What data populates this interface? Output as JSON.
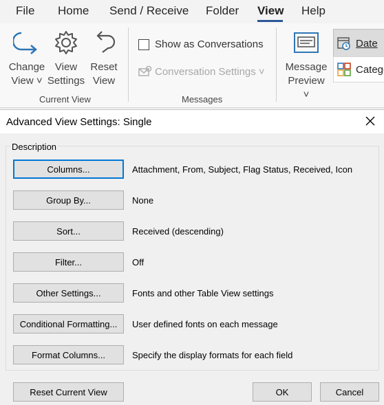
{
  "ribbon": {
    "tabs": [
      {
        "label": "File"
      },
      {
        "label": "Home"
      },
      {
        "label": "Send / Receive"
      },
      {
        "label": "Folder"
      },
      {
        "label": "View"
      },
      {
        "label": "Help"
      }
    ],
    "change_view": {
      "line1": "Change",
      "line2": "View ˅"
    },
    "view_settings": {
      "line1": "View",
      "line2": "Settings"
    },
    "reset_view": {
      "line1": "Reset",
      "line2": "View"
    },
    "current_view_label": "Current View",
    "show_conversations": "Show as Conversations",
    "conversation_settings": "Conversation Settings ˅",
    "messages_label": "Messages",
    "message_preview": {
      "line1": "Message",
      "line2": "Preview ˅"
    },
    "date_label": "Date",
    "categories_label": "Catego"
  },
  "dialog": {
    "title": "Advanced View Settings: Single",
    "description_label": "Description",
    "rows": [
      {
        "button": "Columns...",
        "text": "Attachment, From, Subject, Flag Status, Received, Icon"
      },
      {
        "button": "Group By...",
        "text": "None"
      },
      {
        "button": "Sort...",
        "text": "Received (descending)"
      },
      {
        "button": "Filter...",
        "text": "Off"
      },
      {
        "button": "Other Settings...",
        "text": "Fonts and other Table View settings"
      },
      {
        "button": "Conditional Formatting...",
        "text": "User defined fonts on each message"
      },
      {
        "button": "Format Columns...",
        "text": "Specify the display formats for each field"
      }
    ],
    "reset_button": "Reset Current View",
    "ok_button": "OK",
    "cancel_button": "Cancel"
  },
  "colors": {
    "accent": "#0078d7",
    "ribbon_icon_blue": "#2e75b6",
    "tab_underline": "#2b579a"
  }
}
